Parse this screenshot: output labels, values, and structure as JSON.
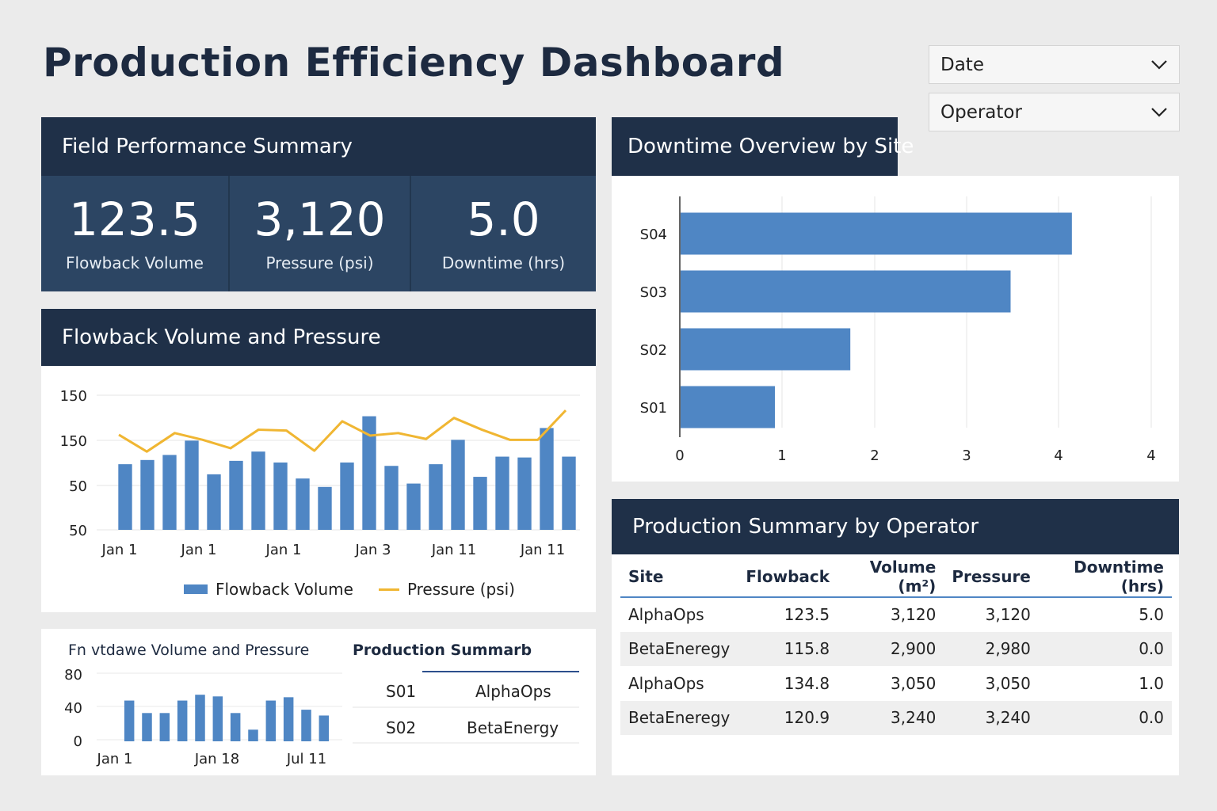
{
  "title": "Production Efficiency Dashboard",
  "filters": [
    {
      "label": "Date",
      "icon": "chevron-down-icon"
    },
    {
      "label": "Operator",
      "icon": "chevron-down-icon"
    }
  ],
  "summary": {
    "heading": "Field Performance Summary",
    "kpis": [
      {
        "value": "123.5",
        "label": "Flowback Volume"
      },
      {
        "value": "3,120",
        "label": "Pressure (psi)"
      },
      {
        "value": "5.0",
        "label": "Downtime (hrs)"
      }
    ]
  },
  "flowback": {
    "heading": "Flowback Volume and Pressure",
    "legend": {
      "bars": "Flowback Volume",
      "line": "Pressure (psi)"
    }
  },
  "downtime": {
    "heading": "Downtime Overview by Site"
  },
  "production": {
    "heading": "Production Summary by Operator",
    "columns": [
      "Site",
      "Flowback",
      "Volume (m²)",
      "Pressure",
      "Downtime (hrs)"
    ],
    "rows": [
      [
        "AlphaOps",
        "123.5",
        "3,120",
        "3,120",
        "5.0"
      ],
      [
        "BetaEneregy",
        "115.8",
        "2,900",
        "2,980",
        "0.0"
      ],
      [
        "AlphaOps",
        "134.8",
        "3,050",
        "3,050",
        "1.0"
      ],
      [
        "BetaEneregy",
        "120.9",
        "3,240",
        "3,240",
        "0.0"
      ]
    ]
  },
  "mini": {
    "chart_title": "Fn vtdawe Volume and Pressure",
    "table_title": "Production Summarb",
    "rows": [
      {
        "site": "S01",
        "operator": "AlphaOps"
      },
      {
        "site": "S02",
        "operator": "BetaEnergy"
      }
    ]
  },
  "colors": {
    "bar": "#4f86c4",
    "line": "#f0b632",
    "header": "#1f3048",
    "kpi": "#2c4563"
  },
  "chart_data": [
    {
      "type": "bar+line",
      "title": "Flowback Volume and Pressure",
      "y_tick_labels": [
        "150",
        "150",
        "50",
        "50"
      ],
      "x_tick_labels": [
        "Jan 1",
        "Jan 1",
        "Jan 1",
        "Jan 3",
        "Jan 11",
        "Jan 11"
      ],
      "series": [
        {
          "name": "Flowback Volume",
          "type": "bar",
          "values": [
            78,
            83,
            89,
            106,
            66,
            82,
            93,
            80,
            61,
            51,
            80,
            135,
            76,
            55,
            78,
            107,
            63,
            87,
            86,
            121,
            87
          ]
        },
        {
          "name": "Pressure (psi)",
          "type": "line",
          "values": [
            113,
            93,
            115,
            107,
            97,
            119,
            118,
            94,
            129,
            112,
            115,
            108,
            133,
            119,
            107,
            107,
            142
          ]
        }
      ]
    },
    {
      "type": "bar",
      "orientation": "horizontal",
      "title": "Downtime Overview by Site",
      "categories": [
        "S04",
        "S03",
        "S02",
        "S01"
      ],
      "values": [
        4.15,
        3.5,
        1.8,
        1.0
      ],
      "x_tick_labels": [
        "0",
        "1",
        "2",
        "3",
        "4",
        "4"
      ],
      "xlim": [
        0,
        5
      ]
    },
    {
      "type": "bar",
      "title": "Fn vtdawe Volume and Pressure",
      "y_tick_labels": [
        "80",
        "40",
        "0"
      ],
      "x_tick_labels": [
        "Jan 1",
        "Jan 18",
        "Jul 11"
      ],
      "ylim": [
        0,
        80
      ],
      "values": [
        49,
        34,
        34,
        49,
        56,
        54,
        34,
        14,
        49,
        53,
        38,
        31
      ]
    }
  ]
}
